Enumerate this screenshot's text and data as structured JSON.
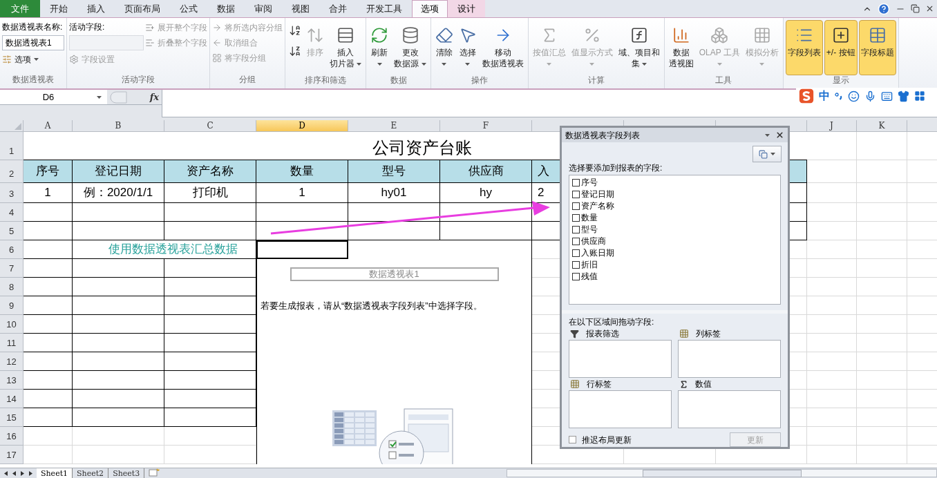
{
  "ribbon_tabs": [
    {
      "label": "文件",
      "kind": "file",
      "selected": false
    },
    {
      "label": "开始",
      "kind": "normal",
      "selected": false
    },
    {
      "label": "插入",
      "kind": "normal",
      "selected": false
    },
    {
      "label": "页面布局",
      "kind": "normal",
      "selected": false
    },
    {
      "label": "公式",
      "kind": "normal",
      "selected": false
    },
    {
      "label": "数据",
      "kind": "normal",
      "selected": false
    },
    {
      "label": "审阅",
      "kind": "normal",
      "selected": false
    },
    {
      "label": "视图",
      "kind": "normal",
      "selected": false
    },
    {
      "label": "合并",
      "kind": "normal",
      "selected": false
    },
    {
      "label": "开发工具",
      "kind": "normal",
      "selected": false
    },
    {
      "label": "选项",
      "kind": "context",
      "selected": true
    },
    {
      "label": "设计",
      "kind": "context",
      "selected": false
    }
  ],
  "ribbon_groups": [
    {
      "title": "数据透视表",
      "columns": [
        [
          {
            "kind": "label",
            "label": "数据透视表名称:"
          },
          {
            "kind": "input",
            "value": "数据透视表1",
            "disabled": false
          },
          {
            "kind": "small",
            "label": "选项",
            "dropdown": true,
            "disabled": false
          }
        ]
      ]
    },
    {
      "title": "活动字段",
      "columns": [
        [
          {
            "kind": "label",
            "label": "活动字段:"
          },
          {
            "kind": "input",
            "disabled": true
          },
          {
            "kind": "small",
            "label": "字段设置",
            "disabled": true
          }
        ],
        [
          {
            "kind": "small",
            "label": "展开整个字段",
            "disabled": true
          },
          {
            "kind": "small",
            "label": "折叠整个字段",
            "disabled": true
          }
        ]
      ]
    },
    {
      "title": "分组",
      "columns": [
        [
          {
            "kind": "small",
            "label": "将所选内容分组",
            "disabled": true
          },
          {
            "kind": "small",
            "label": "取消组合",
            "disabled": true
          },
          {
            "kind": "small",
            "label": "将字段分组",
            "disabled": true
          }
        ]
      ]
    },
    {
      "title": "排序和筛选",
      "columns": [
        [
          {
            "kind": "icon_button",
            "disabled": false
          },
          {
            "kind": "icon_button",
            "disabled": false
          }
        ],
        [
          {
            "kind": "large",
            "lines": [
              "排序"
            ],
            "disabled": true
          }
        ],
        [
          {
            "kind": "large",
            "lines": [
              "插入",
              "切片器"
            ],
            "dropdown": true,
            "disabled": false
          }
        ]
      ]
    },
    {
      "title": "数据",
      "columns": [
        [
          {
            "kind": "large",
            "lines": [
              "刷新"
            ],
            "dropdown": true,
            "disabled": false
          }
        ],
        [
          {
            "kind": "large",
            "lines": [
              "更改",
              "数据源"
            ],
            "dropdown": true,
            "disabled": false
          }
        ]
      ]
    },
    {
      "title": "操作",
      "columns": [
        [
          {
            "kind": "large",
            "lines": [
              "清除"
            ],
            "dropdown": true,
            "disabled": false
          }
        ],
        [
          {
            "kind": "large",
            "lines": [
              "选择"
            ],
            "dropdown": true,
            "disabled": false
          }
        ],
        [
          {
            "kind": "large",
            "lines": [
              "移动",
              "数据透视表"
            ],
            "disabled": false
          }
        ]
      ]
    },
    {
      "title": "计算",
      "columns": [
        [
          {
            "kind": "large",
            "lines": [
              "按值汇总"
            ],
            "dropdown": true,
            "disabled": true
          }
        ],
        [
          {
            "kind": "large",
            "lines": [
              "值显示方式"
            ],
            "dropdown": true,
            "disabled": true
          }
        ],
        [
          {
            "kind": "large",
            "lines": [
              "域、项目和",
              "集"
            ],
            "dropdown": true,
            "disabled": false
          }
        ]
      ]
    },
    {
      "title": "工具",
      "columns": [
        [
          {
            "kind": "large",
            "lines": [
              "数据",
              "透视图"
            ],
            "disabled": false
          }
        ],
        [
          {
            "kind": "large",
            "lines": [
              "OLAP 工具"
            ],
            "dropdown": true,
            "disabled": true
          }
        ],
        [
          {
            "kind": "large",
            "lines": [
              "模拟分析"
            ],
            "dropdown": true,
            "disabled": true
          }
        ]
      ]
    },
    {
      "title": "显示",
      "columns": [
        [
          {
            "kind": "large",
            "lines": [
              "字段列表"
            ],
            "disabled": false,
            "selected": true
          }
        ],
        [
          {
            "kind": "large",
            "lines": [
              "+/- 按钮"
            ],
            "disabled": false,
            "selected": true
          }
        ],
        [
          {
            "kind": "large",
            "lines": [
              "字段标题"
            ],
            "disabled": false,
            "selected": true
          }
        ]
      ]
    }
  ],
  "ime_bar": {
    "mode": "中"
  },
  "formula_bar": {
    "name_box": "D6",
    "fx": "fx"
  },
  "sheet": {
    "columns": [
      {
        "letter": "A",
        "selected": false
      },
      {
        "letter": "B",
        "selected": false
      },
      {
        "letter": "C",
        "selected": false
      },
      {
        "letter": "D",
        "selected": true
      },
      {
        "letter": "E",
        "selected": false
      },
      {
        "letter": "F",
        "selected": false
      },
      {
        "selected": false
      },
      {
        "selected": false
      },
      {
        "selected": false
      },
      {
        "letter": "J",
        "selected": false
      },
      {
        "letter": "K",
        "selected": false
      }
    ],
    "rows": [
      {
        "number": "1",
        "kind": "title",
        "title": "公司资产台账"
      },
      {
        "number": "2",
        "kind": "header",
        "cells": [
          {
            "text": "序号"
          },
          {
            "text": "登记日期"
          },
          {
            "text": "资产名称"
          },
          {
            "text": "数量"
          },
          {
            "text": "型号"
          },
          {
            "text": "供应商"
          },
          {
            "text": "入"
          }
        ]
      },
      {
        "number": "3",
        "kind": "data",
        "cells": [
          {
            "text": "1"
          },
          {
            "text": "例：2020/1/1"
          },
          {
            "text": "打印机"
          },
          {
            "text": "1"
          },
          {
            "text": "hy01"
          },
          {
            "text": "hy"
          },
          {
            "text": "2"
          }
        ]
      },
      {
        "number": "4",
        "kind": "data"
      },
      {
        "number": "5",
        "kind": "data"
      },
      {
        "number": "6",
        "kind": "lower",
        "cells": [
          null,
          {
            "text": "使用数据透视表汇总数据",
            "kind": "note"
          },
          null,
          {
            "active": true
          }
        ]
      },
      {
        "number": "7",
        "kind": "lower"
      },
      {
        "number": "8",
        "kind": "lower"
      },
      {
        "number": "9",
        "kind": "lower"
      },
      {
        "number": "10",
        "kind": "lower"
      },
      {
        "number": "11",
        "kind": "lower"
      },
      {
        "number": "12",
        "kind": "lower"
      },
      {
        "number": "13",
        "kind": "lower"
      },
      {
        "number": "14",
        "kind": "lower"
      },
      {
        "number": "15",
        "kind": "lower"
      },
      {
        "number": "16",
        "kind": "plain"
      },
      {
        "number": "17",
        "kind": "plain"
      }
    ]
  },
  "pivot_placeholder": {
    "name": "数据透视表1",
    "hint": "若要生成报表，请从“数据透视表字段列表”中选择字段。"
  },
  "field_list": {
    "title": "数据透视表字段列表",
    "choose_label": "选择要添加到报表的字段:",
    "fields": [
      {
        "label": "序号",
        "checked": false
      },
      {
        "label": "登记日期",
        "checked": false
      },
      {
        "label": "资产名称",
        "checked": false
      },
      {
        "label": "数量",
        "checked": false
      },
      {
        "label": "型号",
        "checked": false
      },
      {
        "label": "供应商",
        "checked": false
      },
      {
        "label": "入账日期",
        "checked": false
      },
      {
        "label": "折旧",
        "checked": false
      },
      {
        "label": "残值",
        "checked": false
      }
    ],
    "drag_label": "在以下区域间拖动字段:",
    "areas": [
      {
        "label": "报表筛选",
        "kind": "filter"
      },
      {
        "label": "列标签",
        "kind": "columns"
      },
      {
        "label": "行标签",
        "kind": "rows"
      },
      {
        "label": "数值",
        "kind": "values"
      }
    ],
    "defer": {
      "label": "推迟布局更新",
      "checked": false
    },
    "update_button": {
      "label": "更新",
      "disabled": true
    }
  },
  "sheet_tabs": [
    {
      "label": "Sheet1",
      "selected": true
    },
    {
      "label": "Sheet2",
      "selected": false
    },
    {
      "label": "Sheet3",
      "selected": false
    }
  ]
}
